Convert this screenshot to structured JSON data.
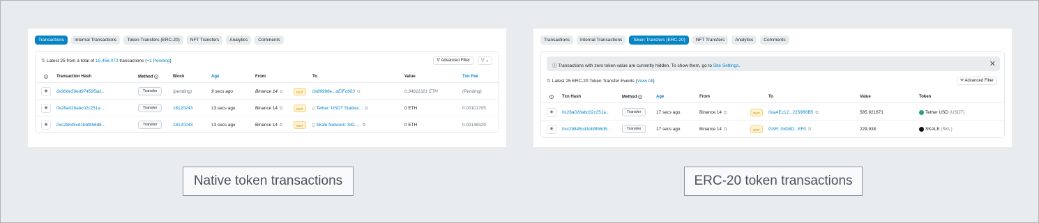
{
  "native": {
    "tabs": [
      "Transactions",
      "Internal Transactions",
      "Token Transfers (ERC-20)",
      "NFT Transfers",
      "Analytics",
      "Comments"
    ],
    "summary": {
      "prefix": "Latest 25 from a total of ",
      "total": "15,456,072",
      "mid": " transactions (",
      "pending": "+1 Pending",
      "suffix": ")"
    },
    "advanced_filter": "Advanced Filter",
    "filter_icon": "filter-icon",
    "headers": {
      "hash": "Transaction Hash",
      "method": "Method",
      "block": "Block",
      "age": "Age",
      "from": "From",
      "to": "To",
      "value": "Value",
      "fee": "Txn Fee"
    },
    "rows": [
      {
        "hash": "0x906e59ed974595ad...",
        "method": "Transfer",
        "block": "(pending)",
        "age": "9 secs ago",
        "from": "Binance 14",
        "dir": "OUT",
        "to": "0x89996e...dEfFc603",
        "value": "0.34611321 ETH",
        "fee": "(Pending)"
      },
      {
        "hash": "0x28a028abc02c251a...",
        "method": "Transfer",
        "block": "18120243",
        "age": "13 secs ago",
        "from": "Binance 14",
        "dir": "OUT",
        "to": "Tether: USDT Stablec...",
        "value": "0 ETH",
        "fee": "0.00101705"
      },
      {
        "hash": "0xc29845cd1bbf856d5...",
        "method": "Transfer",
        "block": "18120243",
        "age": "13 secs ago",
        "from": "Binance 14",
        "dir": "OUT",
        "to": "Skale Network: SKL ...",
        "value": "0 ETH",
        "fee": "0.00148329"
      }
    ],
    "caption": "Native token transactions"
  },
  "erc20": {
    "tabs": [
      "Transactions",
      "Internal Transactions",
      "Token Transfers (ERC-20)",
      "NFT Transfers",
      "Analytics",
      "Comments"
    ],
    "alert": {
      "text": "Transactions with zero token value are currently hidden. To show them, go to ",
      "link": "Site Settings",
      "end": "."
    },
    "summary": {
      "prefix": "Latest 25 ERC-20 Token Transfer Events (",
      "link": "View All",
      "suffix": ")"
    },
    "advanced_filter": "Advanced Filter",
    "headers": {
      "hash": "Txn Hash",
      "method": "Method",
      "age": "Age",
      "from": "From",
      "to": "To",
      "value": "Value",
      "token": "Token"
    },
    "rows": [
      {
        "hash": "0x28a028abc02c251a...",
        "method": "Transfer",
        "age": "17 secs ago",
        "from": "Binance 14",
        "dir": "OUT",
        "to": "0xaAEc12...2259B6B5",
        "value": "585.921671",
        "token_name": "Tether USD",
        "token_symbol": "(USDT)",
        "token_color": "#26a17b"
      },
      {
        "hash": "0xc29845cd1bbf856d5...",
        "method": "Transfer",
        "age": "17 secs ago",
        "from": "Binance 14",
        "dir": "OUT",
        "to": "GSR: 0xD8D...EF0",
        "value": "229,938",
        "token_name": "SKALE",
        "token_symbol": "(SKL)",
        "token_color": "#111111"
      }
    ],
    "caption": "ERC-20 token transactions"
  },
  "colors": {
    "accent": "#0784c3",
    "out_badge": "#fff3cd"
  }
}
